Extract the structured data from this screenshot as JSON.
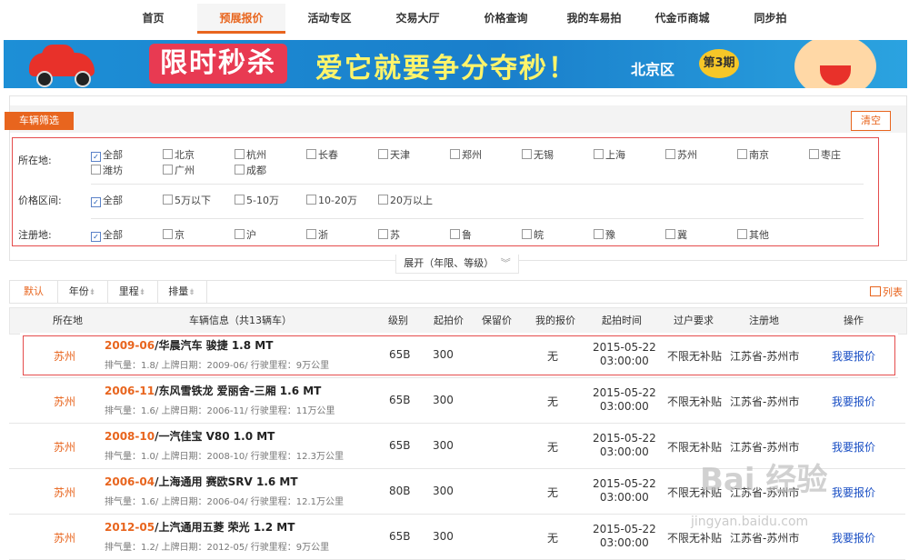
{
  "nav": {
    "items": [
      "首页",
      "预展报价",
      "活动专区",
      "交易大厅",
      "价格查询",
      "我的车易拍",
      "代金币商城",
      "同步拍"
    ],
    "active_index": 1
  },
  "banner": {
    "title": "限时秒杀",
    "slogan": "爱它就要争分夺秒！",
    "region": "北京区",
    "issue": "第3期"
  },
  "filter": {
    "tab_label": "车辆筛选",
    "clear_label": "清空",
    "location": {
      "label": "所在地:",
      "options": [
        "全部",
        "北京",
        "杭州",
        "长春",
        "天津",
        "郑州",
        "无锡",
        "上海",
        "苏州",
        "南京",
        "枣庄",
        "潍坊",
        "广州",
        "成都"
      ],
      "checked": "全部"
    },
    "price": {
      "label": "价格区间:",
      "options": [
        "全部",
        "5万以下",
        "5-10万",
        "10-20万",
        "20万以上"
      ],
      "checked": "全部"
    },
    "registration": {
      "label": "注册地:",
      "options": [
        "全部",
        "京",
        "沪",
        "浙",
        "苏",
        "鲁",
        "皖",
        "豫",
        "冀",
        "其他"
      ],
      "checked": "全部"
    },
    "expand_label": "展开（年限、等级）"
  },
  "sortbar": {
    "items": [
      "默认",
      "年份",
      "里程",
      "排量"
    ],
    "active": "默认",
    "list_label": "列表"
  },
  "table": {
    "headers": [
      "所在地",
      "车辆信息（共13辆车）",
      "级别",
      "起拍价",
      "保留价",
      "我的报价",
      "起拍时间",
      "过户要求",
      "注册地",
      "操作"
    ],
    "rows": [
      {
        "city": "苏州",
        "year": "2009-06",
        "name": "/华晨汽车 骏捷 1.8 MT",
        "detail": "排气量：1.8/ 上牌日期：2009-06/ 行驶里程：9万公里",
        "grade": "65B",
        "start_price": "300",
        "reserve": "",
        "my_bid": "无",
        "date": "2015-05-22",
        "time": "03:00:00",
        "transfer": "不限无补贴",
        "reg": "江苏省-苏州市",
        "action": "我要报价"
      },
      {
        "city": "苏州",
        "year": "2006-11",
        "name": "/东风雪铁龙 爱丽舍-三厢 1.6 MT",
        "detail": "排气量：1.6/ 上牌日期：2006-11/ 行驶里程：11万公里",
        "grade": "65B",
        "start_price": "300",
        "reserve": "",
        "my_bid": "无",
        "date": "2015-05-22",
        "time": "03:00:00",
        "transfer": "不限无补贴",
        "reg": "江苏省-苏州市",
        "action": "我要报价"
      },
      {
        "city": "苏州",
        "year": "2008-10",
        "name": "/一汽佳宝 V80 1.0 MT",
        "detail": "排气量：1.0/ 上牌日期：2008-10/ 行驶里程：12.3万公里",
        "grade": "65B",
        "start_price": "300",
        "reserve": "",
        "my_bid": "无",
        "date": "2015-05-22",
        "time": "03:00:00",
        "transfer": "不限无补贴",
        "reg": "江苏省-苏州市",
        "action": "我要报价"
      },
      {
        "city": "苏州",
        "year": "2006-04",
        "name": "/上海通用 赛欧SRV 1.6 MT",
        "detail": "排气量：1.6/ 上牌日期：2006-04/ 行驶里程：12.1万公里",
        "grade": "80B",
        "start_price": "300",
        "reserve": "",
        "my_bid": "无",
        "date": "2015-05-22",
        "time": "03:00:00",
        "transfer": "不限无补贴",
        "reg": "江苏省-苏州市",
        "action": "我要报价"
      },
      {
        "city": "苏州",
        "year": "2012-05",
        "name": "/上汽通用五菱 荣光 1.2 MT",
        "detail": "排气量：1.2/ 上牌日期：2012-05/ 行驶里程：9万公里",
        "grade": "65B",
        "start_price": "300",
        "reserve": "",
        "my_bid": "无",
        "date": "2015-05-22",
        "time": "03:00:00",
        "transfer": "不限无补贴",
        "reg": "江苏省-苏州市",
        "action": "我要报价"
      }
    ]
  },
  "watermark": {
    "text": "Bai 经验",
    "sub": "jingyan.baidu.com"
  },
  "colors": {
    "accent": "#e8651e",
    "link": "#1a4fc4",
    "highlight_border": "#e54c4c"
  }
}
